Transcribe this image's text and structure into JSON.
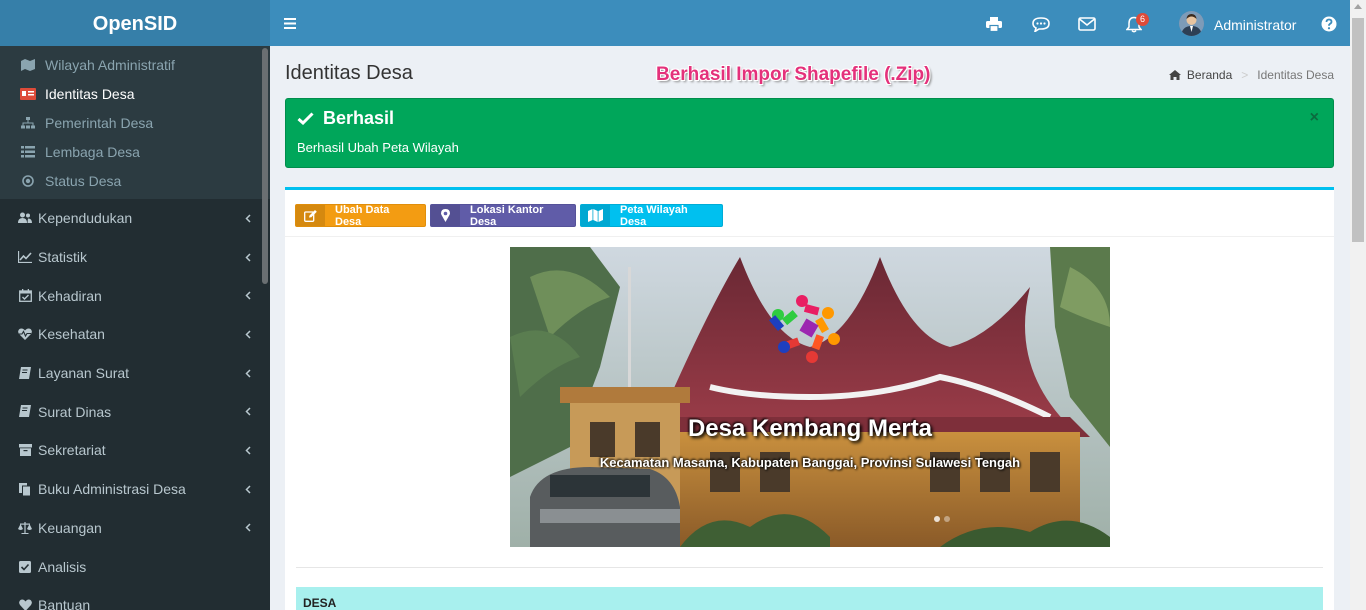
{
  "app": {
    "title": "OpenSID"
  },
  "sidebar": {
    "sub_items": [
      {
        "label": "Wilayah Administratif",
        "icon": "map-icon",
        "active": false
      },
      {
        "label": "Identitas Desa",
        "icon": "id-card-icon",
        "active": true
      },
      {
        "label": "Pemerintah Desa",
        "icon": "sitemap-icon",
        "active": false
      },
      {
        "label": "Lembaga Desa",
        "icon": "list-icon",
        "active": false
      },
      {
        "label": "Status Desa",
        "icon": "dot-circle-icon",
        "active": false
      }
    ],
    "items": [
      {
        "label": "Kependudukan",
        "icon": "users-icon"
      },
      {
        "label": "Statistik",
        "icon": "line-chart-icon"
      },
      {
        "label": "Kehadiran",
        "icon": "calendar-check-icon"
      },
      {
        "label": "Kesehatan",
        "icon": "heartbeat-icon"
      },
      {
        "label": "Layanan Surat",
        "icon": "book-icon"
      },
      {
        "label": "Surat Dinas",
        "icon": "book-icon"
      },
      {
        "label": "Sekretariat",
        "icon": "archive-icon"
      },
      {
        "label": "Buku Administrasi Desa",
        "icon": "copy-icon"
      },
      {
        "label": "Keuangan",
        "icon": "balance-scale-icon"
      },
      {
        "label": "Analisis",
        "icon": "check-square-icon"
      },
      {
        "label": "Bantuan",
        "icon": "heart-icon"
      }
    ]
  },
  "header": {
    "user_name": "Administrator",
    "notification_count": "6",
    "icons": [
      "bars-icon",
      "print-icon",
      "comments-icon",
      "envelope-icon",
      "bell-icon",
      "question-circle-icon"
    ]
  },
  "page": {
    "title": "Identitas Desa",
    "banner": "Berhasil Impor Shapefile (.Zip)",
    "breadcrumb_home": "Beranda",
    "breadcrumb_sep": ">",
    "breadcrumb_current": "Identitas Desa"
  },
  "alert": {
    "title": "Berhasil",
    "message": "Berhasil Ubah Peta Wilayah",
    "close": "×"
  },
  "toolbar": {
    "edit_label": "Ubah Data Desa",
    "location_label": "Lokasi Kantor Desa",
    "map_label": "Peta Wilayah Desa"
  },
  "hero": {
    "title": "Desa Kembang Merta",
    "subtitle": "Kecamatan Masama, Kabupaten Banggai, Provinsi Sulawesi Tengah"
  },
  "section": {
    "title": "DESA"
  },
  "colors": {
    "header": "#3c8dbc",
    "logo": "#367fa9",
    "sidebar": "#222d32",
    "success": "#00a65a",
    "warning": "#f39c12",
    "purple": "#605ca8",
    "info": "#00c0ef",
    "banner": "#e4317b"
  }
}
